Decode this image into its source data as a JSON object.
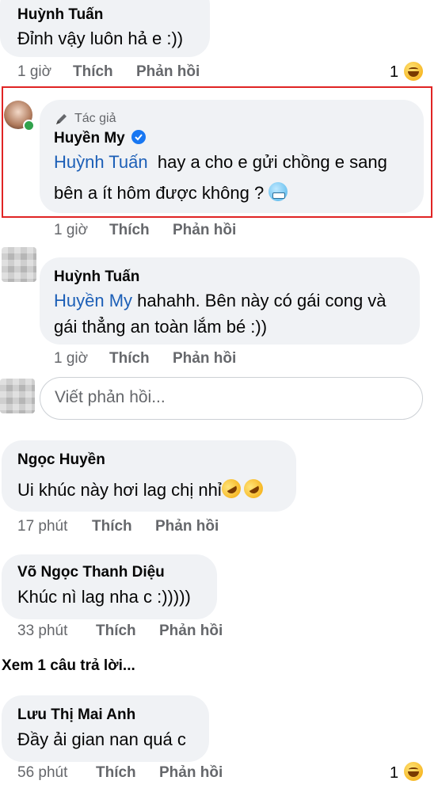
{
  "comments": [
    {
      "name": "Huỳnh Tuấn",
      "text": "Đỉnh vậy luôn hả e :))",
      "time": "1 giờ",
      "like": "Thích",
      "reply": "Phản hồi",
      "reaction_count": "1",
      "reaction_icon": "laughing-emoji-icon"
    },
    {
      "author_badge": "Tác giả",
      "name": "Huyền My",
      "verified_icon": "verified-badge-icon",
      "mention": "Huỳnh Tuấn",
      "text_line1": "hay a cho e gửi chồng e sang",
      "text_line2": "bên a ít hôm được không ?",
      "emoji": "cold-face-emoji-icon",
      "time": "1 giờ",
      "like": "Thích",
      "reply": "Phản hồi",
      "highlight_color": "#e02424"
    },
    {
      "name": "Huỳnh Tuấn",
      "mention": "Huyền My",
      "text_line1": "hahahh. Bên này có gái cong và",
      "text_line2": "gái thẳng an toàn lắm bé :))",
      "time": "1 giờ",
      "like": "Thích",
      "reply": "Phản hồi"
    },
    {
      "name": "Ngọc Huyền",
      "text": "Ui khúc này hơi lag chị nhỉ",
      "emoji": "rolling-laughing-emoji-icon",
      "time": "17 phút",
      "like": "Thích",
      "reply": "Phản hồi"
    },
    {
      "name": "Võ Ngọc Thanh Diệu",
      "text": "Khúc nì lag nha c :)))))",
      "time": "33 phút",
      "like": "Thích",
      "reply": "Phản hồi"
    },
    {
      "name": "Lưu Thị Mai Anh",
      "text": "Đầy ải gian nan quá c",
      "time": "56 phút",
      "like": "Thích",
      "reply": "Phản hồi",
      "reaction_count": "1",
      "reaction_icon": "laughing-emoji-icon"
    }
  ],
  "reply_input": {
    "placeholder": "Viết phản hồi..."
  },
  "view_replies": "Xem 1 câu trả lời...",
  "colors": {
    "bubble": "#f0f2f5",
    "mention": "#1c5fb7",
    "meta": "#65676b",
    "online": "#31a24c"
  }
}
